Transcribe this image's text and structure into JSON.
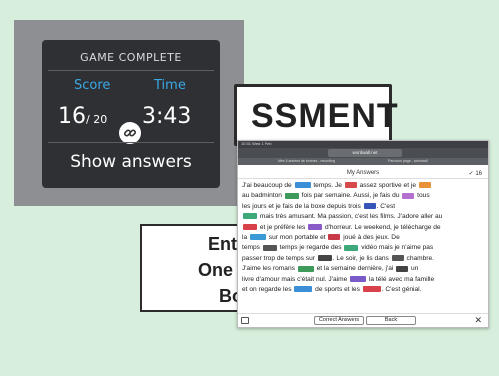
{
  "game": {
    "title": "GAME COMPLETE",
    "score_label": "Score",
    "time_label": "Time",
    "score_value": "16",
    "score_total": "/ 20",
    "time_value": "3:43",
    "show_answers_label": "Show answers",
    "accent_color": "#3aa9e6"
  },
  "banner": {
    "assessment_text": "SSMENT",
    "enter_line1": "Enter",
    "enter_line2": "One at",
    "enter_line3": "Bon"
  },
  "phone": {
    "status": "10:31  Wed 1 Feb",
    "url": "wordwall.net",
    "tab1": "Mes 4 années de bonnes - recording",
    "tab2": "Parcours page - wordwall",
    "header_title": "My Answers",
    "score_check": "✓ 16",
    "text": {
      "l1a": "J'ai beaucoup de ",
      "l1b": " temps. Je ",
      "l1c": " assez sportive et je ",
      "l2a": "au badminton ",
      "l2b": " fois par semaine. Aussi, je fais du ",
      "l2c": " tous",
      "l3a": "les jours et je fais de la boxe depuis trois ",
      "l3b": ". C'est",
      "l4a": " mais très amusant. Ma passion, c'est les films. J'adore aller au",
      "l5a": " et je préfère les ",
      "l5b": " d'horreur. Le weekend, je télécharge de",
      "l6a": "la ",
      "l6b": " sur mon portable et ",
      "l6c": " joué à des jeux. De",
      "l7a": "temps ",
      "l7b": " temps je regarde des ",
      "l7c": " vidéo mais je n'aime pas",
      "l8a": "passer trop de temps sur ",
      "l8b": ". Le soir, je lis dans ",
      "l8c": " chambre.",
      "l9a": "J'aime les romans ",
      "l9b": " et la semaine dernière, j'ai ",
      "l9c": " un",
      "l10a": "livre d'amour mais c'était nul. J'aime ",
      "l10b": " la télé avec ma famille",
      "l11a": "et on regarde les ",
      "l11b": " de sports et les ",
      "l11c": ". C'est génial."
    },
    "correct_answers_label": "Correct Answers",
    "back_label": "Back",
    "close_symbol": "✕"
  }
}
